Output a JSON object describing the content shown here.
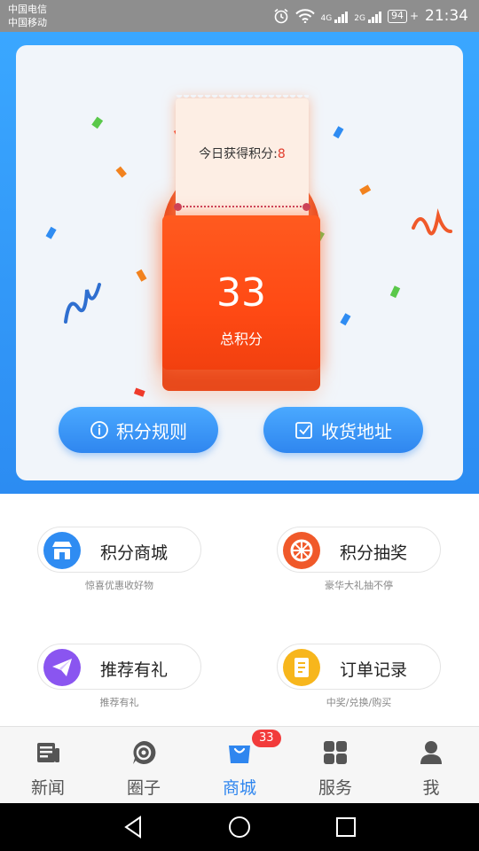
{
  "status_bar": {
    "carrier_1": "中国电信",
    "carrier_2": "中国移动",
    "signal_1_label": "4G",
    "signal_2_label": "2G",
    "battery": "94",
    "time": "21:34"
  },
  "points_card": {
    "today_label": "今日获得积分:",
    "today_value": "8",
    "total_points": "33",
    "total_label": "总积分",
    "rules_button": "积分规则",
    "address_button": "收货地址"
  },
  "features": [
    {
      "label": "积分商城",
      "sub": "惊喜优惠收好物",
      "icon": "shop-icon",
      "color": "#2f8cf2"
    },
    {
      "label": "积分抽奖",
      "sub": "豪华大礼抽不停",
      "icon": "lottery-wheel-icon",
      "color": "#f0592a"
    },
    {
      "label": "推荐有礼",
      "sub": "推荐有礼",
      "icon": "paper-plane-icon",
      "color": "#8a55f0"
    },
    {
      "label": "订单记录",
      "sub": "中奖/兑换/购买",
      "icon": "order-record-icon",
      "color": "#f7b61c"
    }
  ],
  "tabbar": {
    "tabs": [
      {
        "label": "新闻",
        "icon": "news-icon"
      },
      {
        "label": "圈子",
        "icon": "circle-icon"
      },
      {
        "label": "商城",
        "icon": "shopping-bag-icon",
        "active": true
      },
      {
        "label": "服务",
        "icon": "services-grid-icon"
      },
      {
        "label": "我",
        "icon": "profile-icon"
      }
    ],
    "mall_badge": "33"
  },
  "colors": {
    "primary": "#2f86ef",
    "envelope": "#ff4a14",
    "badge": "#f23b3b"
  }
}
